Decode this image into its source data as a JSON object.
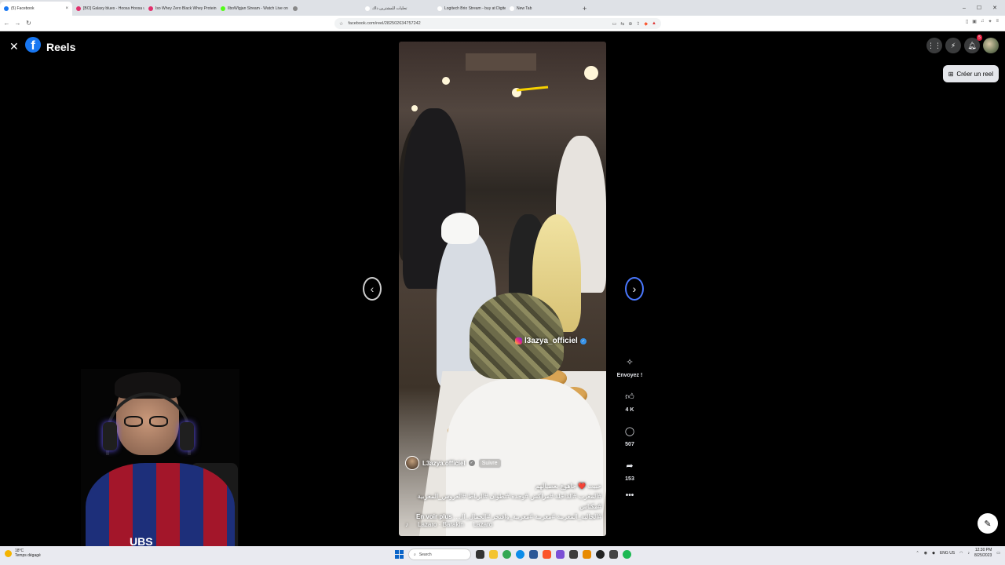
{
  "browser": {
    "tabs": [
      {
        "label": "(5) Facebook",
        "color": "#1877f2",
        "active": true
      },
      {
        "label": "[BO] Galaxy blues - Hoosa Hoosa up",
        "color": "#e1306c",
        "active": false
      },
      {
        "label": "Iso Whey Zero Black Whey Protein",
        "color": "#e1306c",
        "active": false
      },
      {
        "label": "IlboWlgjan Stream - Watch Live on",
        "color": "#53fc18",
        "active": false
      },
      {
        "label": "",
        "color": "#888888",
        "active": false
      },
      {
        "label": "تحليات للمشترين داك",
        "color": "#ffffff",
        "active": false
      },
      {
        "label": "Logitech Brio Stream - buy at Digitec",
        "color": "#ffffff",
        "active": false
      },
      {
        "label": "New Tab",
        "color": "#ffffff",
        "active": false
      }
    ],
    "new_tab": "+",
    "url": "facebook.com/reel/282502634757242"
  },
  "header": {
    "close": "✕",
    "logo": "f",
    "title": "Reels",
    "notif_count": "5",
    "create_reel": "Créer un reel"
  },
  "reel": {
    "ig_handle": "l3azya_officiel",
    "author": "L3azya.officiel",
    "follow": "Suivre",
    "caption_line1": "حبيت ❤️ جاهوع بعضيالهم",
    "caption_line2": "#المغرب #الداخلة #مراكش #وجدة #تطوان #الرباط #العروس_المغربية #مكناس",
    "caption_line3": "#الجالية_المغربية #مغربية #مغربية_وافتخر #الجمال_ال...",
    "see_more": "En voir plus",
    "audio_artist": "Lazaro · Barakin",
    "audio_track": "Lazaro"
  },
  "actions": {
    "send_label": "Envoyez !",
    "likes": "4 K",
    "comments": "507",
    "shares": "153",
    "more": "•••"
  },
  "nav": {
    "prev": "‹",
    "next": "›"
  },
  "webcam": {
    "jersey_text": "UBS"
  },
  "taskbar": {
    "temp": "18°C",
    "weather": "Temps dégagé",
    "search": "Search",
    "lang": "ENG US",
    "time": "12:30 PM",
    "date": "8/25/2023"
  }
}
